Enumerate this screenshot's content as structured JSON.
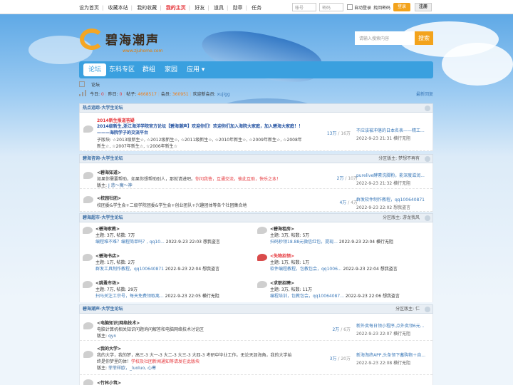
{
  "topbar": {
    "links": [
      "设为首页",
      "收藏本站",
      "我的收藏",
      "我的主页",
      "好友",
      "道具",
      "勋章",
      "任务"
    ],
    "active_index": 3,
    "account_placeholder": "帐号",
    "password_placeholder": "密码",
    "auto_login": "自动登录",
    "forgot": "找回密码",
    "login": "登录",
    "register": "注册"
  },
  "logo": {
    "title": "碧海潮声",
    "url": "www.zjuhome.com"
  },
  "search": {
    "placeholder": "请输入搜索内容",
    "button": "搜索"
  },
  "nav": {
    "items": [
      "论坛",
      "东科专区",
      "群组",
      "家园",
      "应用"
    ]
  },
  "breadcrumb": {
    "text": "论坛"
  },
  "stats": {
    "today_label": "今日:",
    "today": "0",
    "yesterday_label": "昨日:",
    "yesterday": "0",
    "posts_label": "帖子:",
    "posts": "4668517",
    "members_label": "会员:",
    "members": "360951",
    "newest_label": "欢迎新会员:",
    "newest": "xujigg",
    "latest": "最新回复"
  },
  "sections": [
    {
      "title": "热点追踪-大学生论坛",
      "moderator": "",
      "forums": [
        {
          "badge": "2014新生报道答疑",
          "name": "2014级新生,浙江海洋学院官方论坛【碧海潮声】欢迎你们！欢迎你们加入海院大家庭，加入碧海大家庭！！———海院学子的交流平台",
          "sub": "子版块: ☆2013级新生☆, ☆2012级新生☆, ☆2011级新生☆, ☆2010年新生☆, ☆2009年新生☆, ☆2008年新生☆, ☆2007年新生☆, ☆2006年新生☆",
          "threads": "13万",
          "posts": "16万",
          "last_title": "不应该被冲落的日本名表——精工...",
          "last_meta": "2022-9-23 21:31 横行无阻"
        }
      ]
    },
    {
      "title": "碧海咨询-大学生论坛",
      "moderator": "分区版主: 梦想不再有",
      "forums": [
        {
          "name": "<碧海知道>",
          "desc_a": "如果你需要帮助，如果你想帮助别人，那就请进吧。",
          "desc_b": "你问我答，互通交流，彼此互助，快乐之本！",
          "mod_label": "版主:",
          "mods": "J 悲～魔～神",
          "threads": "2万",
          "posts": "10万",
          "last_title": "purelive酵素洗脚粉，能深度滋润...",
          "last_meta": "2022-9-23 21:32 横行无阻"
        },
        {
          "name": "<校园社团>",
          "desc": "校团委&学生会+二级学院团委&学生会+创业团队+兴趣团体等各个社团集合地",
          "threads": "4万",
          "posts": "4万",
          "last_title": "群发软件制作教程，qq100640871",
          "last_meta": "2022-9-23 22:02 想我盗言"
        }
      ]
    },
    {
      "title": "碧海超市-大学生论坛",
      "moderator": "分区版主: 游龙我风",
      "cells": [
        {
          "name": "<碧海家教>",
          "stat": "主题: 3万, 帖数: 7万",
          "last_title": "编程难不难？编程简单吗？, qq10...",
          "last_meta": "2022-9-23 22:03 想我盗言"
        },
        {
          "name": "<碧海租房>",
          "stat": "主题: 3万, 帖数: 5万",
          "last_title": "扫码秒领18.88元微信红包，提现...",
          "last_meta": "2022-9-23 22:04 横行无阻"
        },
        {
          "name": "<碧海书店>",
          "stat": "主题: 1万, 帖数: 2万",
          "last_title": "群发工具制作教程，qq100640871",
          "last_meta": "2022-9-23 22:04 想我盗言"
        },
        {
          "name": "<失物招领>",
          "stat": "主题: 1万, 帖数: 1万",
          "last_title": "软件编程教程，包教包会，qq1006...",
          "last_meta": "2022-9-23 22:04 想我盗言",
          "hot": true
        },
        {
          "name": "<跳蚤市场>",
          "stat": "主题: 7万, 帖数: 29万",
          "last_title": "扫马关注工宗号，每天免费领取离...",
          "last_meta": "2022-9-23 22:05 横行无阻"
        },
        {
          "name": "<求职招聘>",
          "stat": "主题: 3万, 帖数: 11万",
          "last_title": "编程培训，包教包会，qq10064087...",
          "last_meta": "2022-9-23 22:06 想我盗言"
        }
      ]
    },
    {
      "title": "碧海潮声-大学生论坛",
      "moderator": "分区版主: 仁",
      "forums": [
        {
          "name": "<电脑知识|网络技术>",
          "desc": "电脑计算机相关知识问题询问解答和电脑网络技术讨论区",
          "mod_label": "版主:",
          "mods": "qyn",
          "threads": "2万",
          "posts": "6万",
          "last_title": "新外卖每日领小程序,点外卖领6元...",
          "last_meta": "2022-9-23 22:07 横行无阻"
        },
        {
          "name": "<我的大学>",
          "desc": "我的大学，我的梦，高三-3 大一-3 大二-3 大三-3 大四-3 考研中毕业工作。无论天涯海角，我的大学始",
          "desc2": "终是你梦里的体！",
          "desc2b": "学校及社团新闻通知等请发在此版块",
          "mod_label": "版主:",
          "mods": "菲菲样欧，_luoluo, 心寒",
          "threads": "3万",
          "posts": "20万",
          "last_title": "新海淘终APP,头条领下蓄购物＋自...",
          "last_meta": "2022-9-23 22:08 横行无阻"
        },
        {
          "name": "<竹林小筑>"
        }
      ]
    }
  ],
  "colors": {
    "accent": "#3aa0df",
    "orange": "#f3a31c",
    "red": "#e5353a"
  }
}
